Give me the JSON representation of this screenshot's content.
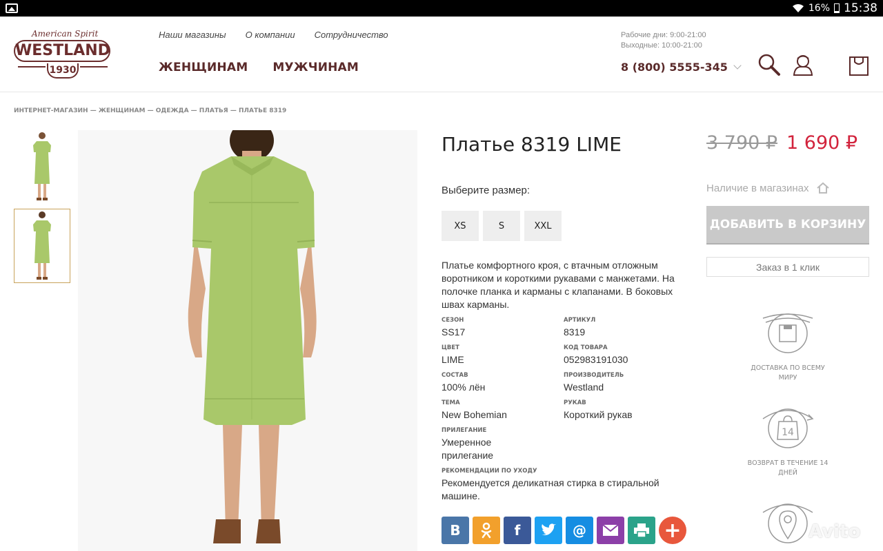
{
  "status_bar": {
    "battery": "16%",
    "time": "15:38"
  },
  "header": {
    "logo": {
      "script_text": "American Spirit",
      "brand": "WESTLAND",
      "year": "1930"
    },
    "top_nav": [
      "Наши магазины",
      "О компании",
      "Сотрудничество"
    ],
    "main_nav": [
      "ЖЕНЩИНАМ",
      "МУЖЧИНАМ"
    ],
    "hours_weekdays": "Рабочие дни: 9:00-21:00",
    "hours_weekend": "Выходные: 10:00-21:00",
    "phone": "8 (800) 5555-345"
  },
  "breadcrumb": "ИНТЕРНЕТ-МАГАЗИН — ЖЕНЩИНАМ — ОДЕЖДА — ПЛАТЬЯ — ПЛАТЬЕ 8319",
  "product": {
    "title": "Платье 8319 LIME",
    "size_label": "Выберите размер:",
    "sizes": [
      "XS",
      "S",
      "XXL"
    ],
    "description": "Платье комфортного кроя, с втачным отложным воротником и короткими рукавами с манжетами. На полочке планка и карманы с клапанами. В боковых швах карманы.",
    "specs": [
      {
        "key": "СЕЗОН",
        "value": "SS17"
      },
      {
        "key": "АРТИКУЛ",
        "value": "8319"
      },
      {
        "key": "ЦВЕТ",
        "value": "LIME"
      },
      {
        "key": "КОД ТОВАРА",
        "value": "052983191030"
      },
      {
        "key": "СОСТАВ",
        "value": "100% лён"
      },
      {
        "key": "ПРОИЗВОДИТЕЛЬ",
        "value": "Westland"
      },
      {
        "key": "ТЕМА",
        "value": "New Bohemian"
      },
      {
        "key": "РУКАВ",
        "value": "Короткий рукав"
      },
      {
        "key": "ПРИЛЕГАНИЕ",
        "value": "Умеренное прилегание"
      },
      {
        "key": "РЕКОМЕНДАЦИИ ПО УХОДУ",
        "value": "Рекомендуется деликатная стирка в стиральной машине."
      }
    ],
    "shares": [
      {
        "label": "В",
        "color": "#4a76a8"
      },
      {
        "label": "ok",
        "color": "#f2a02c"
      },
      {
        "label": "f",
        "color": "#3b5998"
      },
      {
        "label": "tw",
        "color": "#1da1f2"
      },
      {
        "label": "@",
        "color": "#168de2"
      },
      {
        "label": "mail",
        "color": "#8c3fa8"
      },
      {
        "label": "print",
        "color": "#2ba38a"
      },
      {
        "label": "+",
        "color": "#e8573c"
      }
    ]
  },
  "purchase": {
    "old_price": "3 790 ₽",
    "new_price": "1 690 ₽",
    "availability": "Наличие в магазинах",
    "add_to_cart": "ДОБАВИТЬ В КОРЗИНУ",
    "one_click": "Заказ в 1 клик",
    "features": [
      {
        "icon": "delivery-box-icon",
        "label": "ДОСТАВКА ПО ВСЕМУ МИРУ"
      },
      {
        "icon": "return-14-icon",
        "label": "ВОЗВРАТ В ТЕЧЕНИЕ 14 ДНЕЙ"
      },
      {
        "icon": "map-pin-icon",
        "label": ""
      }
    ]
  },
  "watermark": "Avito",
  "colors": {
    "brand": "#6b2d2d",
    "sale_price": "#d2233c",
    "dress": "#a9c86a",
    "thumb_active_border": "#c8a25a"
  }
}
